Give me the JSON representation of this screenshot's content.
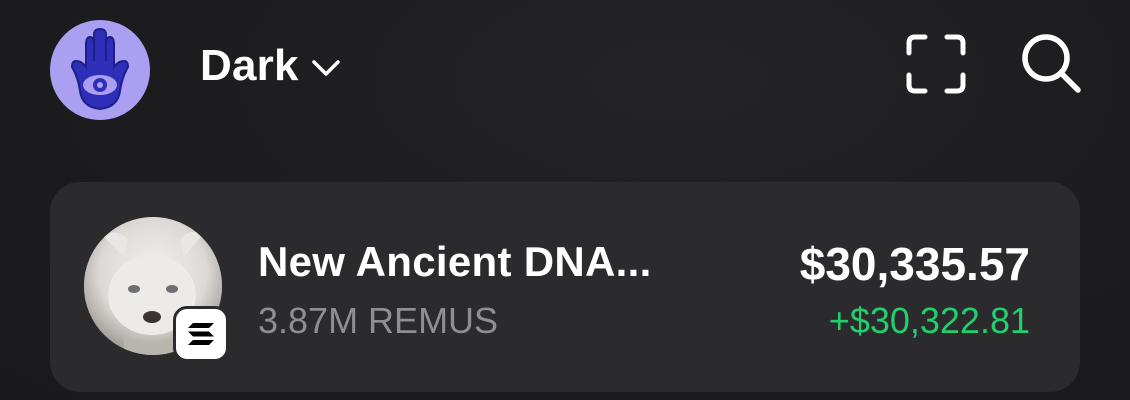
{
  "header": {
    "account_name": "Dark",
    "avatar_icon": "hamsa-eye-icon",
    "avatar_color": "#ab9ff2",
    "scan_icon": "scan-frame-icon",
    "search_icon": "search-icon"
  },
  "token": {
    "name": "New Ancient DNA...",
    "balance": "3.87M REMUS",
    "value": "$30,335.57",
    "change": "+$30,322.81",
    "change_color": "#21d06c",
    "chain_icon": "solana-icon"
  }
}
